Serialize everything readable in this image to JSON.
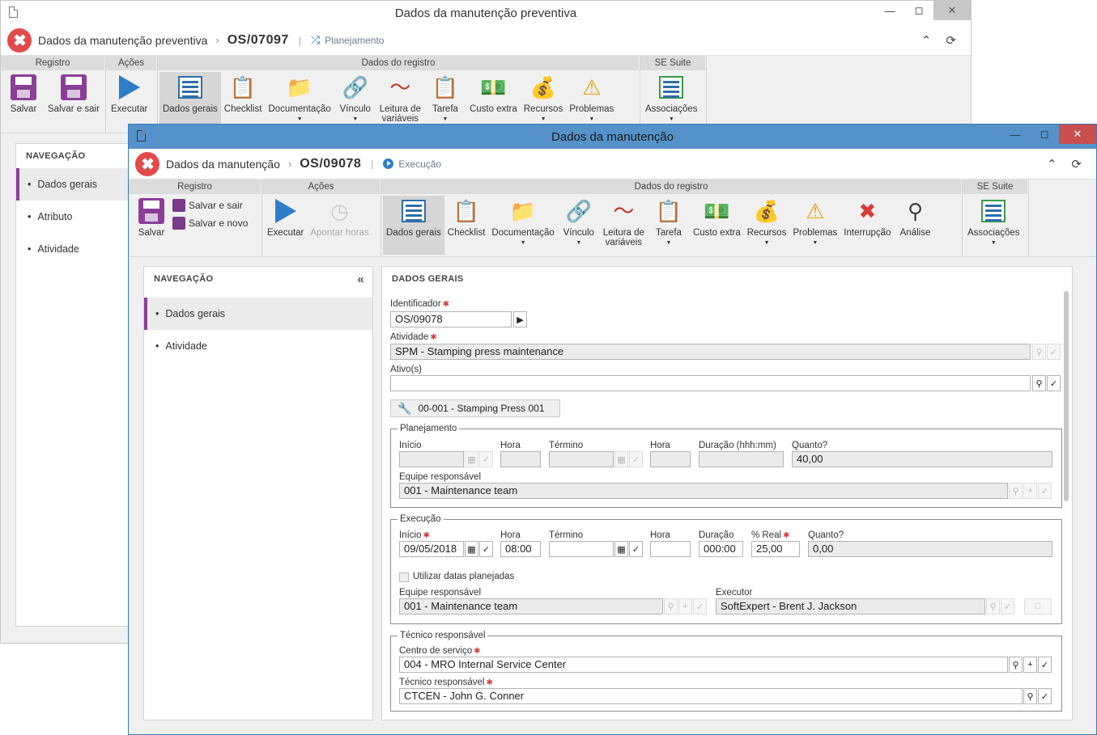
{
  "back_window": {
    "title": "Dados da manutenção preventiva",
    "header_title": "Dados da manutenção preventiva",
    "code": "OS/07097",
    "status": "Planejamento",
    "groups": {
      "registro": "Registro",
      "acoes": "Ações",
      "dados_registro": "Dados do registro",
      "se_suite": "SE Suite"
    },
    "buttons": {
      "salvar": "Salvar",
      "salvar_sair": "Salvar e sair",
      "executar": "Executar",
      "dados_gerais": "Dados gerais",
      "checklist": "Checklist",
      "documentacao": "Documentação",
      "vinculo": "Vínculo",
      "leitura_l1": "Leitura de",
      "leitura_l2": "variáveis",
      "tarefa": "Tarefa",
      "custo_extra": "Custo extra",
      "recursos": "Recursos",
      "problemas": "Problemas",
      "associacoes": "Associações"
    },
    "nav": {
      "heading": "NAVEGAÇÃO",
      "items": [
        "Dados gerais",
        "Atributo",
        "Atividade"
      ]
    }
  },
  "front_window": {
    "title": "Dados da manutenção",
    "header_title": "Dados da manutenção",
    "code": "OS/09078",
    "status": "Execução",
    "groups": {
      "registro": "Registro",
      "acoes": "Ações",
      "dados_registro": "Dados do registro",
      "se_suite": "SE Suite"
    },
    "buttons": {
      "salvar": "Salvar",
      "salvar_sair": "Salvar e sair",
      "salvar_novo": "Salvar e novo",
      "executar": "Executar",
      "apontar_horas": "Apontar horas",
      "dados_gerais": "Dados gerais",
      "checklist": "Checklist",
      "documentacao": "Documentação",
      "vinculo": "Vínculo",
      "leitura_l1": "Leitura de",
      "leitura_l2": "variáveis",
      "tarefa": "Tarefa",
      "custo_extra": "Custo extra",
      "recursos": "Recursos",
      "problemas": "Problemas",
      "interrupcao": "Interrupção",
      "analise": "Análise",
      "associacoes": "Associações"
    },
    "nav": {
      "heading": "NAVEGAÇÃO",
      "items": [
        "Dados gerais",
        "Atividade"
      ]
    },
    "form": {
      "heading": "DADOS GERAIS",
      "identificador_label": "Identificador",
      "identificador_value": "OS/09078",
      "atividade_label": "Atividade",
      "atividade_value": "SPM - Stamping press maintenance",
      "ativos_label": "Ativo(s)",
      "ativos_value": "",
      "asset_chip": "00-001 - Stamping Press 001",
      "planejamento": {
        "legend": "Planejamento",
        "inicio": "Início",
        "hora": "Hora",
        "termino": "Término",
        "hora2": "Hora",
        "duracao": "Duração (hhh:mm)",
        "quanto": "Quanto?",
        "quanto_value": "40,00",
        "equipe_label": "Equipe responsável",
        "equipe_value": "001 - Maintenance team"
      },
      "execucao": {
        "legend": "Execução",
        "inicio": "Início",
        "inicio_value": "09/05/2018",
        "hora": "Hora",
        "hora_value": "08:00",
        "termino": "Término",
        "hora2": "Hora",
        "duracao": "Duração",
        "duracao_value": "000:00",
        "real": "% Real",
        "real_value": "25,00",
        "quanto": "Quanto?",
        "quanto_value": "0,00",
        "utilizar": "Utilizar datas planejadas",
        "equipe_label": "Equipe responsável",
        "equipe_value": "001 - Maintenance team",
        "executor_label": "Executor",
        "executor_value": "SoftExpert - Brent J. Jackson"
      },
      "tecnico": {
        "legend": "Técnico responsável",
        "centro_label": "Centro de serviço",
        "centro_value": "004 - MRO Internal Service Center",
        "tecnico_label": "Técnico responsável",
        "tecnico_value": "CTCEN - John G. Conner"
      }
    }
  },
  "colors": {
    "accent_purple": "#8a3f96",
    "title_blue": "#5592c9",
    "logo_red": "#e24b4b",
    "required_red": "#d63c3c"
  }
}
